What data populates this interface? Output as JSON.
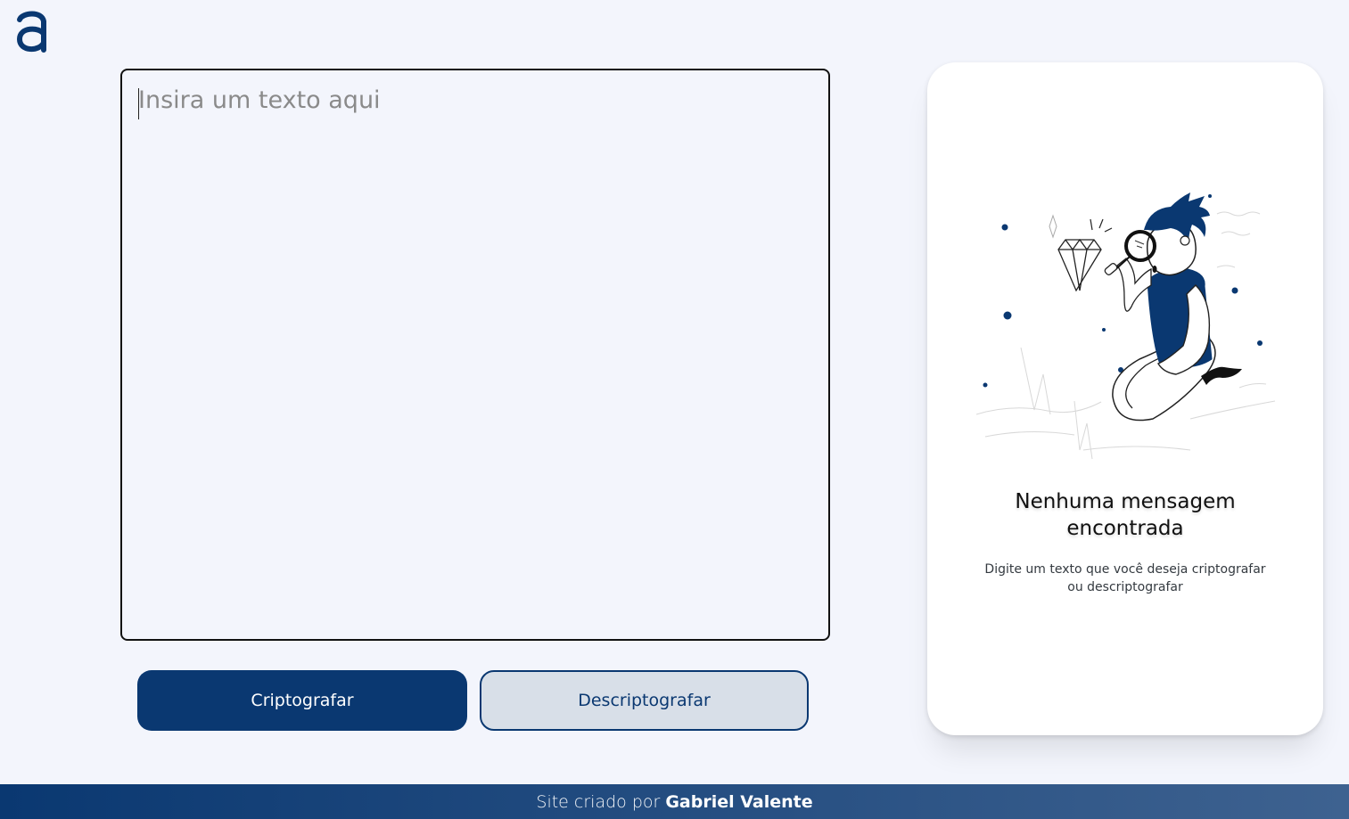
{
  "header": {
    "logo_icon": "letter-a-logo-icon",
    "logo_color": "#0a3871"
  },
  "input": {
    "placeholder": "Insira um texto aqui",
    "value": ""
  },
  "actions": {
    "encrypt_label": "Criptografar",
    "decrypt_label": "Descriptografar"
  },
  "output_panel": {
    "illustration_icon": "boy-with-magnifier-illustration",
    "title_line1": "Nenhuma mensagem",
    "title_line2": "encontrada",
    "subtitle_line1": "Digite um texto que você deseja criptografar",
    "subtitle_line2": "ou descriptografar"
  },
  "footer": {
    "prefix": "Site criado por",
    "author": "Gabriel Valente"
  },
  "colors": {
    "primary": "#0a3871",
    "background": "#f3f5fc",
    "secondary_button": "#d8dfe8"
  }
}
